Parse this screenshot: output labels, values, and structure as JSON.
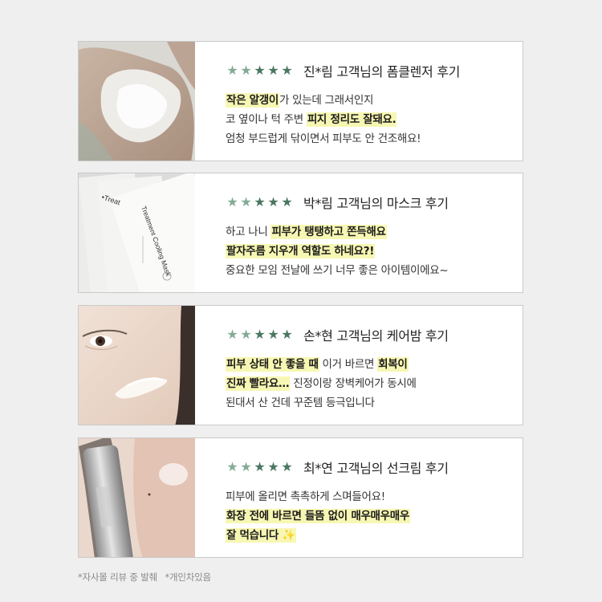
{
  "colors": {
    "star": "#4a7761",
    "star_light": "#84ab96",
    "highlight": "#f7f7b4",
    "background": "#efefef"
  },
  "reviews": [
    {
      "image_icon": "cleanser-foam-on-palm",
      "title": "진*림 고객님의 폼클렌저 후기",
      "lines": [
        [
          {
            "t": "작은 알갱이",
            "h": true
          },
          {
            "t": "가 있는데 그래서인지",
            "h": false
          }
        ],
        [
          {
            "t": "코 옆이나 턱 주변 ",
            "h": false
          },
          {
            "t": "피지 정리도 잘돼요.",
            "h": true
          }
        ],
        [
          {
            "t": "엄청 부드럽게 닦이면서 피부도 안 건조해요!",
            "h": false
          }
        ]
      ]
    },
    {
      "image_icon": "sheet-mask-packages",
      "mask_label": "Treatment Cooling Mask",
      "title": "박*림 고객님의 마스크 후기",
      "lines": [
        [
          {
            "t": "하고 나니 ",
            "h": false
          },
          {
            "t": "피부가 탱탱하고 쫀득해요",
            "h": true
          }
        ],
        [
          {
            "t": "팔자주름 지우개 역할도 하네요?!",
            "h": true
          }
        ],
        [
          {
            "t": "중요한 모임 전날에 쓰기 너무 좋은 아이템이에요~",
            "h": false
          }
        ]
      ]
    },
    {
      "image_icon": "balm-on-cheek",
      "title": "손*현 고객님의 케어밤 후기",
      "lines": [
        [
          {
            "t": "피부 상태 안 좋을 때",
            "h": true
          },
          {
            "t": " 이거 바르면 ",
            "h": false
          },
          {
            "t": "회복이",
            "h": true
          }
        ],
        [
          {
            "t": "진짜 빨라요…",
            "h": true
          },
          {
            "t": " 진정이랑 장벽케어가 동시에",
            "h": false
          }
        ],
        [
          {
            "t": "된대서 산 건데 꾸준템 등극입니다",
            "h": false
          }
        ]
      ]
    },
    {
      "image_icon": "sunscreen-tube-and-face",
      "title": "최*연 고객님의 선크림 후기",
      "lines": [
        [
          {
            "t": "피부에 올리면 촉촉하게 스며들어요!",
            "h": false
          }
        ],
        [
          {
            "t": "화장 전에 바르면 들뜸 없이 매우매우매우",
            "h": true
          }
        ],
        [
          {
            "t": "잘 먹습니다 ✨",
            "h": true
          }
        ]
      ]
    }
  ],
  "footnote": {
    "note1": "*자사몰 리뷰 중 발췌",
    "note2": "*개인차있음"
  }
}
